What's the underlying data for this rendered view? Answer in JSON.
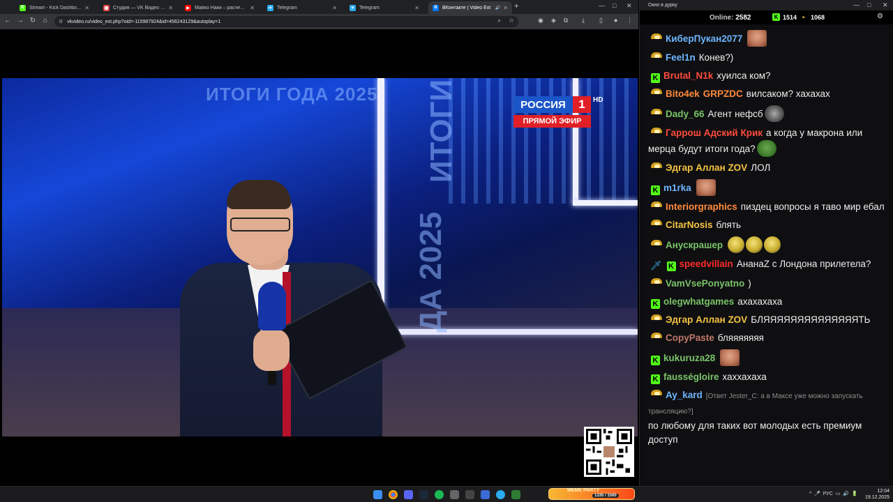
{
  "browser": {
    "tabs": [
      {
        "label": "Stream - Kick Dashboard",
        "favicon_color": "#53fc18",
        "favicon_glyph": "K",
        "active": false
      },
      {
        "label": "Студия — VK Видео Live",
        "favicon_color": "#e64646",
        "favicon_glyph": "▣",
        "active": false
      },
      {
        "label": "Майко Наки – расчеловечиван",
        "favicon_color": "#ff0000",
        "favicon_glyph": "▶",
        "active": false
      },
      {
        "label": "Telegram",
        "favicon_color": "#2aabee",
        "favicon_glyph": "✈",
        "active": false
      },
      {
        "label": "Telegram",
        "favicon_color": "#2aabee",
        "favicon_glyph": "✈",
        "active": false
      },
      {
        "label": "ВКонтакте | Video Ext",
        "favicon_color": "#0077ff",
        "favicon_glyph": "В",
        "active": true
      }
    ],
    "url": "vkvideo.ru/video_ext.php?oid=-115987924&id=456243129&autoplay=1"
  },
  "video": {
    "background_title": "ИТОГИ ГОДА 2025",
    "background_vertical_1": "ИТОГИ",
    "background_vertical_2": "ДА 2025",
    "channel_name": "РОССИЯ",
    "channel_number": "1",
    "channel_hd": "HD",
    "live_label": "ПРЯМОЙ ЭФИР"
  },
  "chat": {
    "window_title": "Окно в дурку",
    "online_label": "Online:",
    "online_count": "2582",
    "kick_viewers": "1514",
    "vk_viewers": "1068",
    "messages": [
      {
        "badges": [
          "vk"
        ],
        "user": "КиберПукан2077",
        "color": "#6eb6ff",
        "text": "",
        "emotes": [
          "face"
        ]
      },
      {
        "badges": [
          "vk"
        ],
        "user": "Feel1n",
        "color": "#6eb6ff",
        "text": "Конев?)",
        "emotes": []
      },
      {
        "badges": [
          "kick"
        ],
        "user": "Brutal_N1k",
        "color": "#ff4b3e",
        "text": "хуилса ком?",
        "emotes": []
      },
      {
        "badges": [
          "vk"
        ],
        "user": "Bito4ek",
        "color": "#ff8a3d",
        "user2": "GRPZDC",
        "color2": "#ff8a3d",
        "text": "вилсаком? хахахах",
        "emotes": []
      },
      {
        "badges": [
          "vk"
        ],
        "user": "Dady_66",
        "color": "#7ac36a",
        "text": "Агент нефсб",
        "emotes": [
          "gremlin"
        ]
      },
      {
        "badges": [
          "vk"
        ],
        "user": "Гаррош Адский Крик",
        "color": "#ff4b3e",
        "text": "а когда у макрона или мерца будут итоги года?",
        "emotes": [
          "pepe"
        ]
      },
      {
        "badges": [
          "vk"
        ],
        "user": "Эдгар Аллан ZOV",
        "color": "#f5c443",
        "text": "ЛОЛ",
        "emotes": []
      },
      {
        "badges": [
          "kick"
        ],
        "user": "m1rka",
        "color": "#6eb6ff",
        "text": "",
        "emotes": [
          "face"
        ]
      },
      {
        "badges": [
          "vk"
        ],
        "user": "Interiorgraphics",
        "color": "#ff8a3d",
        "text": "пиздец вопросы я таво мир ебал",
        "emotes": []
      },
      {
        "badges": [
          "vk"
        ],
        "user": "CitarNosis",
        "color": "#f5c443",
        "text": "блять",
        "emotes": []
      },
      {
        "badges": [
          "vk"
        ],
        "user": "Анускрашер",
        "color": "#7ac36a",
        "text": "",
        "emotes": [
          "ball",
          "ball",
          "ball"
        ]
      },
      {
        "badges": [
          "sword",
          "kick"
        ],
        "user": "speedvillain",
        "color": "#ff2a2a",
        "text": "АнанаZ с Лондона прилетела?",
        "emotes": []
      },
      {
        "badges": [
          "vk"
        ],
        "user": "VamVsePonyatno",
        "color": "#7ac36a",
        "text": ")",
        "emotes": []
      },
      {
        "badges": [
          "kick"
        ],
        "user": "olegwhatgames",
        "color": "#7ac36a",
        "text": "ахахахаха",
        "emotes": []
      },
      {
        "badges": [
          "vk"
        ],
        "user": "Эдгар Аллан ZOV",
        "color": "#f5c443",
        "text": "БЛЯЯЯЯЯЯЯЯЯЯЯЯЯЯТЬ",
        "emotes": []
      },
      {
        "badges": [
          "vk"
        ],
        "user": "CopyPaste",
        "color": "#c0786a",
        "text": "бляяяяяяя",
        "emotes": []
      },
      {
        "badges": [
          "kick"
        ],
        "user": "kukuruza28",
        "color": "#7ac36a",
        "text": "",
        "emotes": [
          "face"
        ]
      },
      {
        "badges": [
          "kick"
        ],
        "user": "fausségloire",
        "color": "#7ac36a",
        "text": "хаххахаха",
        "emotes": []
      },
      {
        "badges": [
          "vk"
        ],
        "user": "Ay_kard",
        "color": "#6eb6ff",
        "reply": "[Ответ Jester_C: а в Максе уже можно запускать трансляцию?]",
        "text": "по любому для таких вот молодых есть премиум доступ",
        "emotes": []
      }
    ]
  },
  "taskbar": {
    "meme_title": "MEME PARTY",
    "meme_count": "1335 / 1500",
    "lang": "РУС",
    "time": "12:04",
    "date": "19.12.2025"
  }
}
